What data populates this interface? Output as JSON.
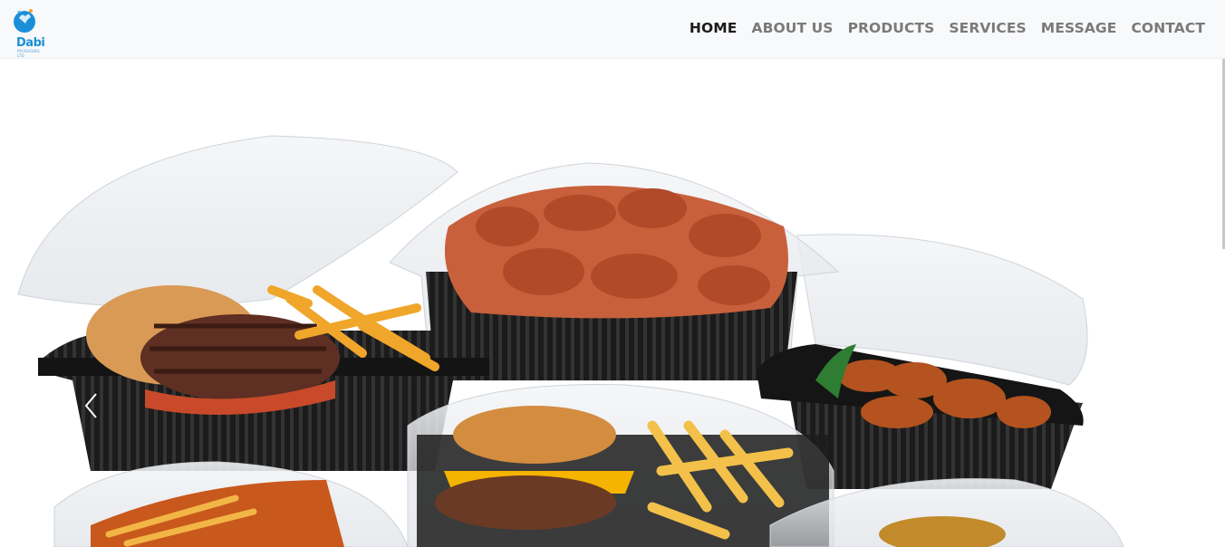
{
  "logo": {
    "text": "Dabi",
    "subtext": "PACKAGING LTD"
  },
  "nav": {
    "items": [
      {
        "label": "HOME",
        "active": true
      },
      {
        "label": "ABOUT US",
        "active": false
      },
      {
        "label": "PRODUCTS",
        "active": false
      },
      {
        "label": "SERVICES",
        "active": false
      },
      {
        "label": "MESSAGE",
        "active": false
      },
      {
        "label": "CONTACT",
        "active": false
      }
    ]
  },
  "hero": {
    "prev_icon": "chevron-left-icon"
  },
  "colors": {
    "nav_bg": "#f8f9fa",
    "nav_active": "#1b1b1b",
    "nav_inactive": "#7a7a7a",
    "logo_blue": "#1a8fd8",
    "container_black": "#1e1e1e"
  }
}
